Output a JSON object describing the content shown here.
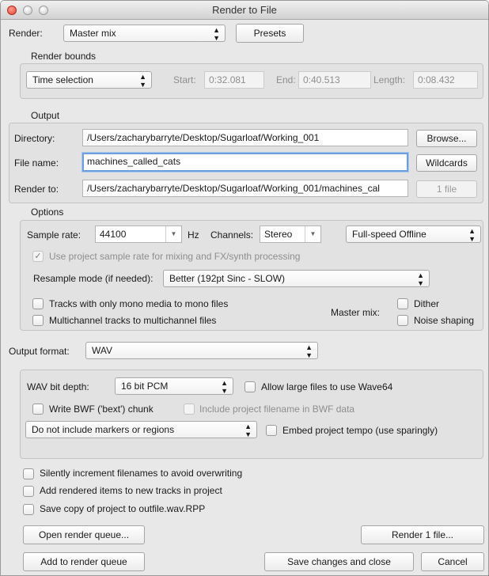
{
  "window": {
    "title": "Render to File"
  },
  "render": {
    "label": "Render:",
    "source": "Master mix",
    "presets": "Presets"
  },
  "bounds": {
    "section": "Render bounds",
    "mode": "Time selection",
    "start_label": "Start:",
    "start": "0:32.081",
    "end_label": "End:",
    "end": "0:40.513",
    "length_label": "Length:",
    "length": "0:08.432"
  },
  "output": {
    "section": "Output",
    "directory_label": "Directory:",
    "directory": "/Users/zacharybarryte/Desktop/Sugarloaf/Working_001",
    "browse": "Browse...",
    "filename_label": "File name:",
    "filename": "machines_called_cats",
    "wildcards": "Wildcards",
    "renderto_label": "Render to:",
    "renderto": "/Users/zacharybarryte/Desktop/Sugarloaf/Working_001/machines_cal",
    "files": "1 file"
  },
  "options": {
    "section": "Options",
    "samplerate_label": "Sample rate:",
    "samplerate": "44100",
    "hz": "Hz",
    "channels_label": "Channels:",
    "channels": "Stereo",
    "speed": "Full-speed Offline",
    "use_project_rate": "Use project sample rate for mixing and FX/synth processing",
    "resample_label": "Resample mode (if needed):",
    "resample": "Better (192pt Sinc - SLOW)",
    "mono_tracks": "Tracks with only mono media to mono files",
    "multichannel": "Multichannel tracks to multichannel files",
    "master_mix_label": "Master mix:",
    "dither": "Dither",
    "noise_shaping": "Noise shaping"
  },
  "format": {
    "label": "Output format:",
    "value": "WAV",
    "bitdepth_label": "WAV bit depth:",
    "bitdepth": "16 bit PCM",
    "wave64": "Allow large files to use Wave64",
    "bwf": "Write BWF ('bext') chunk",
    "bwf_filename": "Include project filename in BWF data",
    "markers": "Do not include markers or regions",
    "tempo": "Embed project tempo (use sparingly)"
  },
  "extras": {
    "increment": "Silently increment filenames to avoid overwriting",
    "add_tracks": "Add rendered items to new tracks in project",
    "save_copy": "Save copy of project to outfile.wav.RPP"
  },
  "buttons": {
    "open_queue": "Open render queue...",
    "render_files": "Render 1 file...",
    "add_queue": "Add to render queue",
    "save_close": "Save changes and close",
    "cancel": "Cancel"
  },
  "icons": {
    "updown": "↕ stepper",
    "down": "▼ dropdown",
    "checkmark": "✓"
  }
}
